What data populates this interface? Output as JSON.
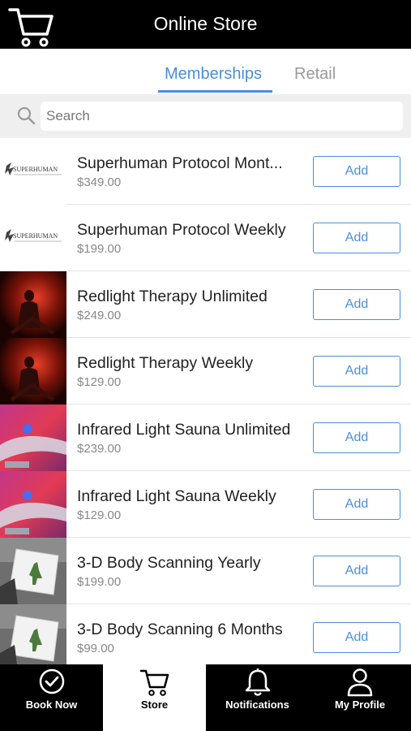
{
  "header": {
    "title": "Online Store",
    "cart_icon": "cart-icon"
  },
  "tabs": [
    {
      "label": "Memberships",
      "active": true
    },
    {
      "label": "Retail",
      "active": false
    }
  ],
  "search": {
    "placeholder": "Search",
    "value": ""
  },
  "colors": {
    "accent": "#4a8fd8",
    "bar": "#000000"
  },
  "products": [
    {
      "name": "Superhuman Protocol Mont...",
      "price": "$349.00",
      "button": "Add",
      "thumb": "superhuman-logo"
    },
    {
      "name": "Superhuman Protocol Weekly",
      "price": "$199.00",
      "button": "Add",
      "thumb": "superhuman-logo"
    },
    {
      "name": "Redlight Therapy Unlimited",
      "price": "$249.00",
      "button": "Add",
      "thumb": "redlight-photo"
    },
    {
      "name": "Redlight Therapy Weekly",
      "price": "$129.00",
      "button": "Add",
      "thumb": "redlight-photo"
    },
    {
      "name": "Infrared Light Sauna Unlimited",
      "price": "$239.00",
      "button": "Add",
      "thumb": "sauna-photo"
    },
    {
      "name": "Infrared Light Sauna Weekly",
      "price": "$129.00",
      "button": "Add",
      "thumb": "sauna-photo"
    },
    {
      "name": "3-D Body Scanning Yearly",
      "price": "$199.00",
      "button": "Add",
      "thumb": "body-scan-photo"
    },
    {
      "name": "3-D Body Scanning 6 Months",
      "price": "$99.00",
      "button": "Add",
      "thumb": "body-scan-photo"
    }
  ],
  "logo_text": "SUPERHUMAN",
  "nav": [
    {
      "label": "Book Now",
      "icon": "check-circle-icon",
      "active": false
    },
    {
      "label": "Store",
      "icon": "cart-icon",
      "active": true
    },
    {
      "label": "Notifications",
      "icon": "bell-icon",
      "active": false
    },
    {
      "label": "My Profile",
      "icon": "person-icon",
      "active": false
    }
  ]
}
